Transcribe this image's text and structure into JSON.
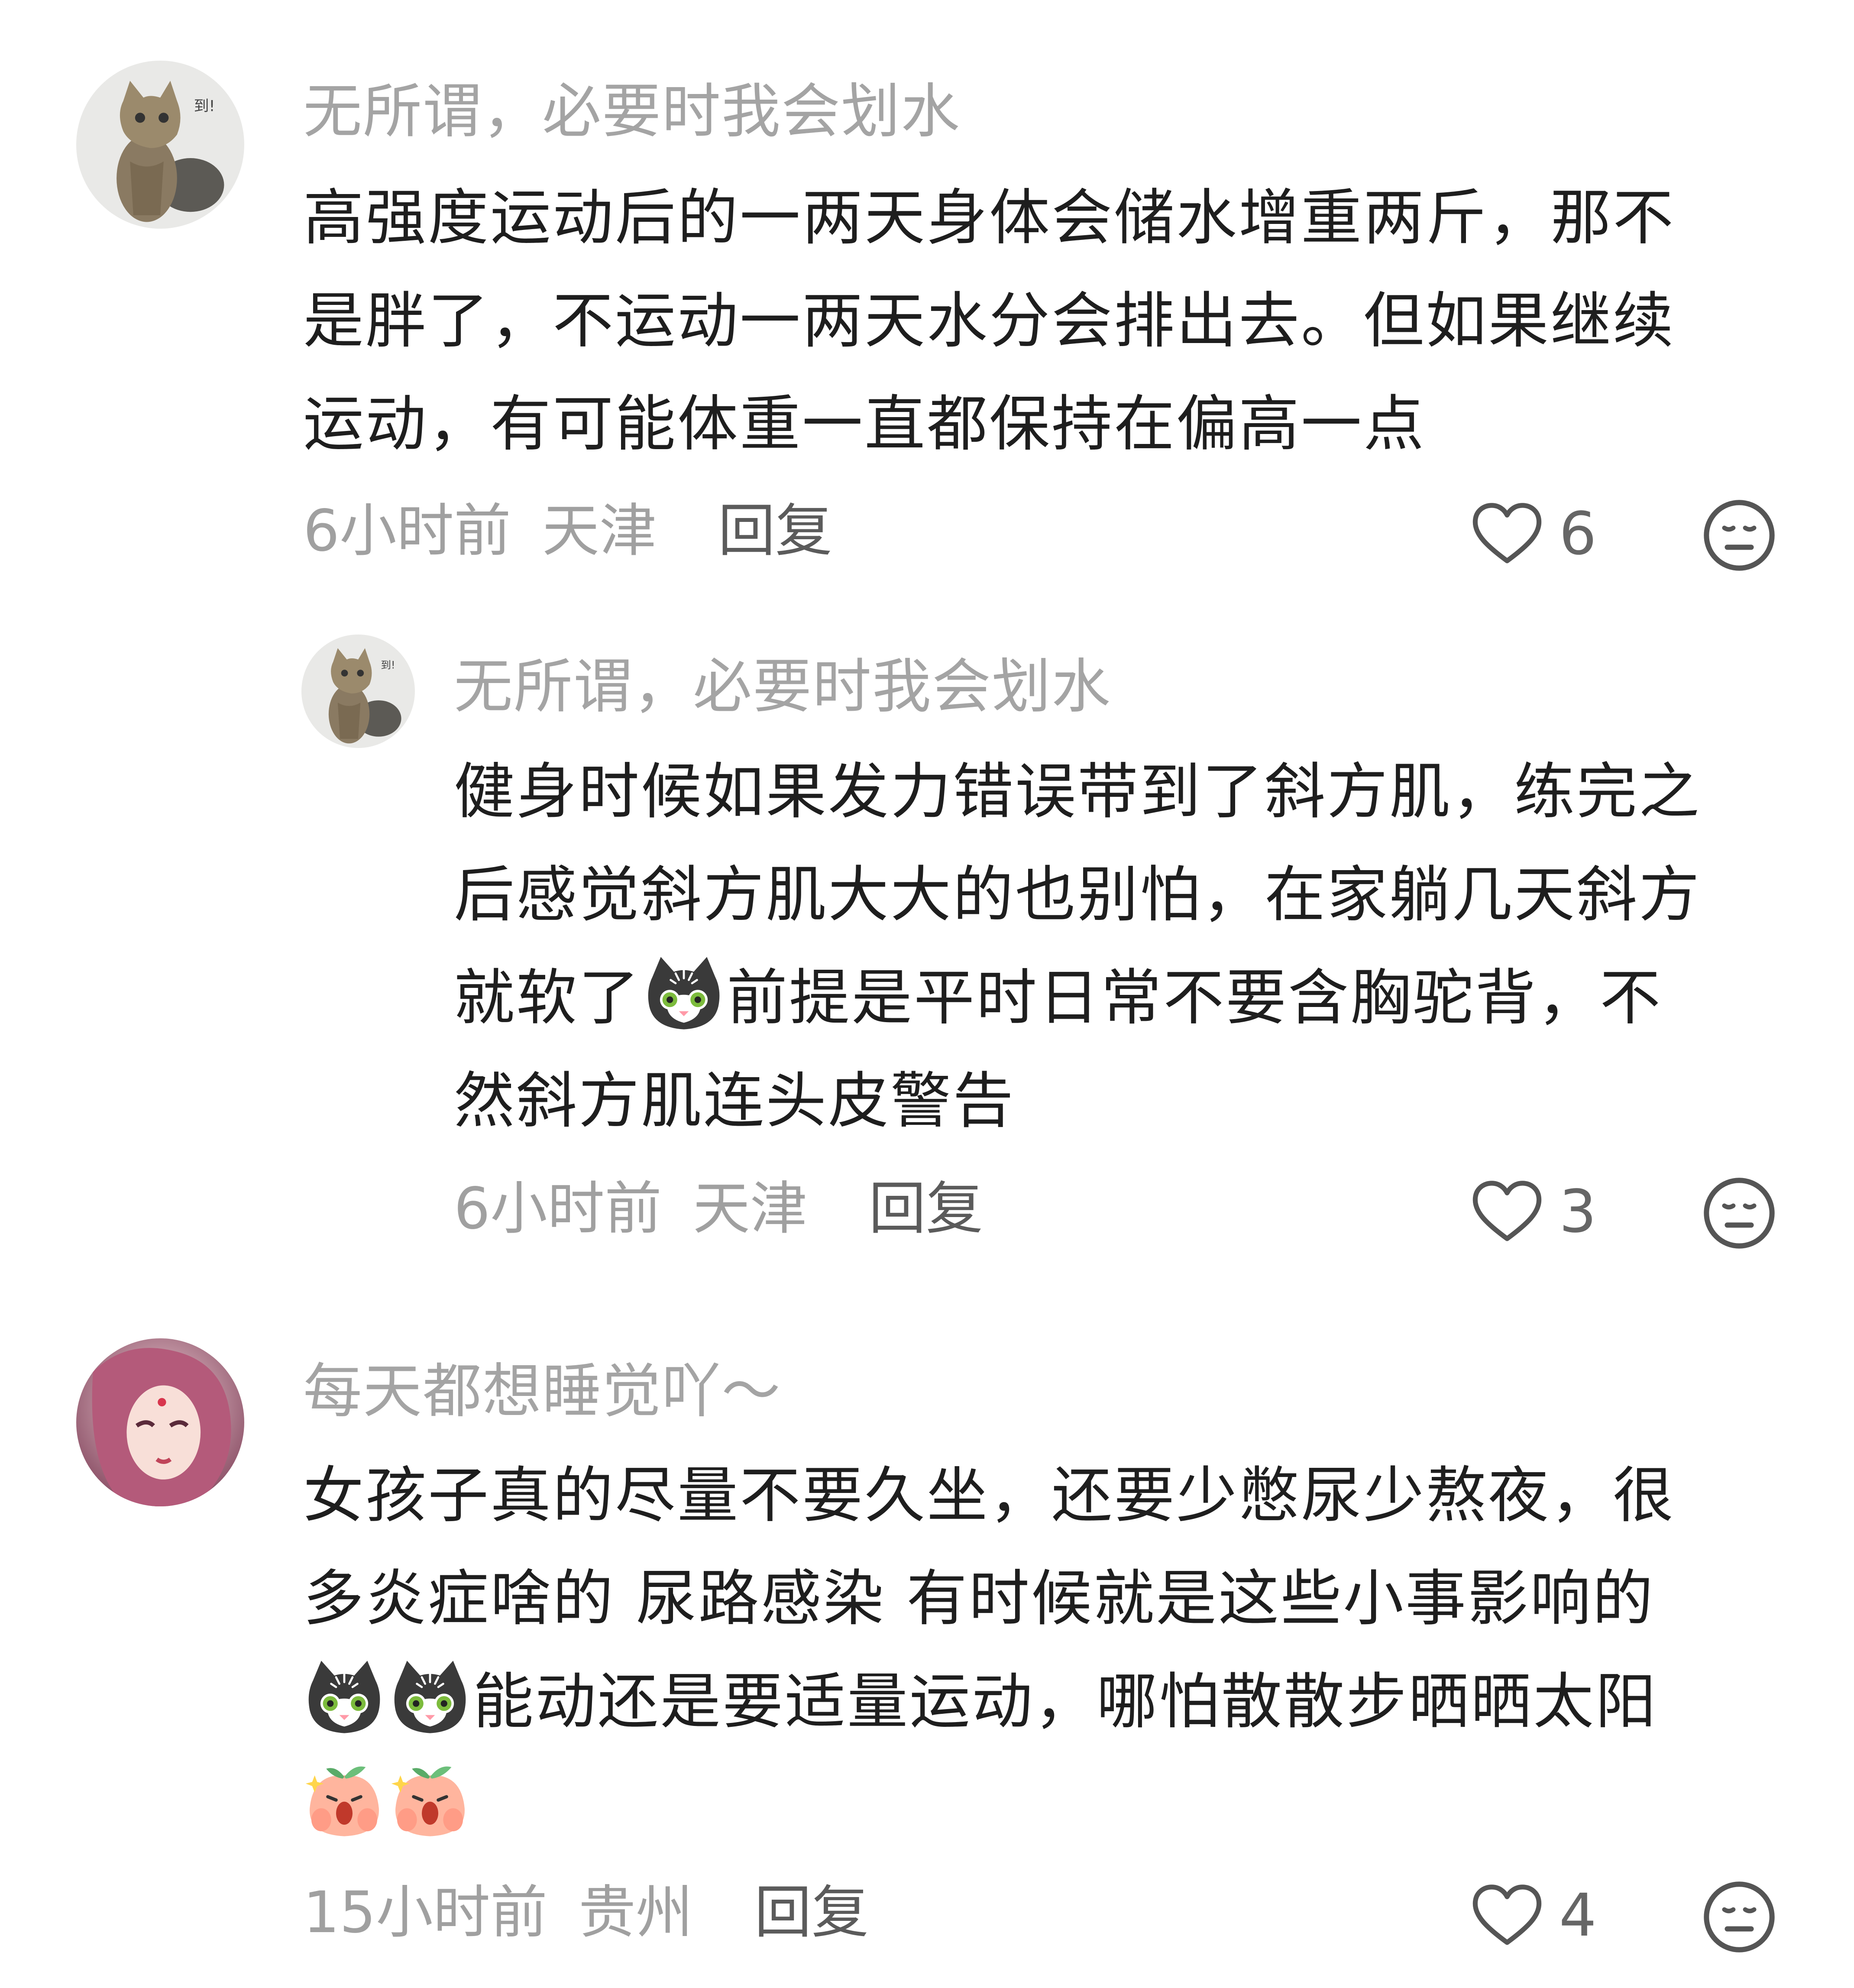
{
  "comments": [
    {
      "username": "无所谓，必要时我会划水",
      "avatar_badge": "到!",
      "lines": [
        "高强度运动后的一两天身体会储水增重两斤，那不",
        "是胖了，不运动一两天水分会排出去。但如果继续",
        "运动，有可能体重一直都保持在偏高一点"
      ],
      "time": "6小时前",
      "location": "天津",
      "reply_label": "回复",
      "likes": "6"
    },
    {
      "username": "无所谓，必要时我会划水",
      "avatar_badge": "到!",
      "lines": [
        "健身时候如果发力错误带到了斜方肌，练完之",
        "后感觉斜方肌大大的也别怕，在家躺几天斜方",
        "就软了",
        "前提是平时日常不要含胸驼背，不",
        "然斜方肌连头皮警告"
      ],
      "time": "6小时前",
      "location": "天津",
      "reply_label": "回复",
      "likes": "3"
    },
    {
      "username": "每天都想睡觉吖～",
      "lines": [
        "女孩子真的尽量不要久坐，还要少憋尿少熬夜，很",
        "多炎症啥的 尿路感染 有时候就是这些小事影响的",
        "能动还是要适量运动，哪怕散散步晒晒太阳"
      ],
      "time": "15小时前",
      "location": "贵州",
      "reply_label": "回复",
      "likes": "4"
    }
  ],
  "colors": {
    "username": "#a4a4a4",
    "text": "#1e1e1e",
    "meta": "#a0a0a0",
    "reply": "#5b5b5b",
    "icon": "#555555"
  },
  "icons": {
    "like": "heart-outline-icon",
    "dislike": "meh-face-icon",
    "emoji_cat": "cat-face-emoji",
    "emoji_peach": "peach-shock-emoji"
  }
}
